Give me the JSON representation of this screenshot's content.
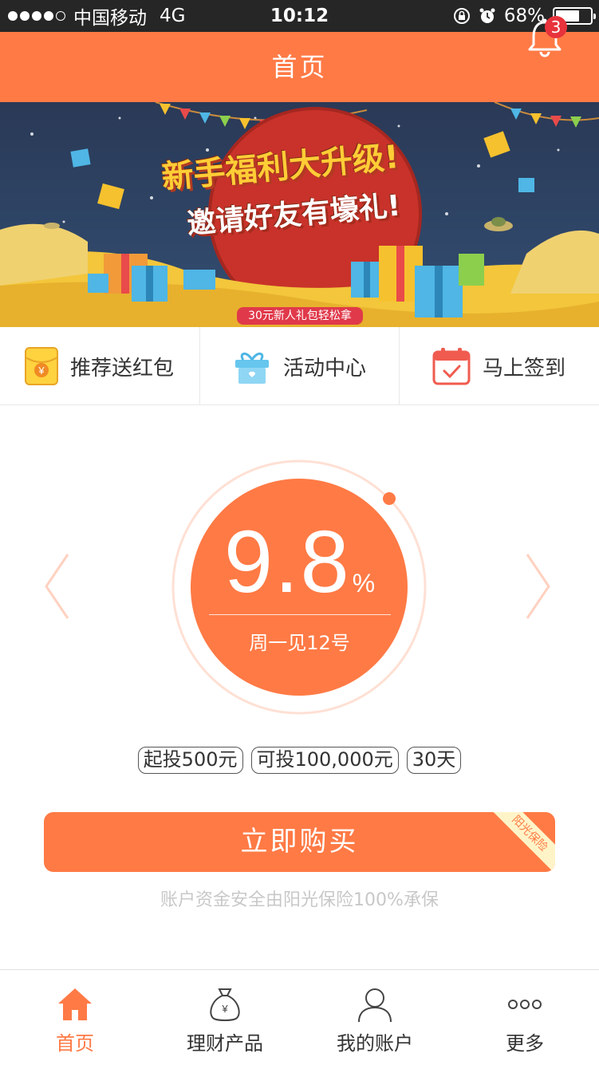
{
  "status_bar": {
    "carrier": "中国移动",
    "network": "4G",
    "time": "10:12",
    "battery": "68%",
    "battery_level": 0.68
  },
  "nav": {
    "title": "首页",
    "notification_count": "3"
  },
  "banner": {
    "headline": "新手福利大升级!",
    "subhead": "邀请好友有壕礼!",
    "tag": "30元新人礼包轻松拿"
  },
  "quick_menu": [
    {
      "label": "推荐送红包",
      "icon": "red-envelope-icon"
    },
    {
      "label": "活动中心",
      "icon": "gift-icon"
    },
    {
      "label": "马上签到",
      "icon": "calendar-check-icon"
    }
  ],
  "product": {
    "rate": "9.8",
    "rate_unit": "%",
    "name": "周一见12号",
    "tags": [
      "起投500元",
      "可投100,000元",
      "30天"
    ],
    "buy_label": "立即购买",
    "insurance_ribbon": "阳光保险",
    "insurance_note": "账户资金安全由阳光保险100%承保"
  },
  "tabs": [
    {
      "label": "首页",
      "icon": "home-icon",
      "active": true
    },
    {
      "label": "理财产品",
      "icon": "money-bag-icon",
      "active": false
    },
    {
      "label": "我的账户",
      "icon": "user-icon",
      "active": false
    },
    {
      "label": "更多",
      "icon": "more-icon",
      "active": false
    }
  ],
  "colors": {
    "accent": "#ff7a45",
    "badge": "#e8323c",
    "status_bar": "#262626"
  }
}
